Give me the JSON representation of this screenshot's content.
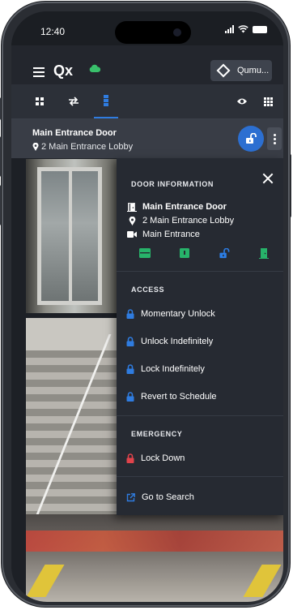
{
  "status_bar": {
    "time": "12:40"
  },
  "header": {
    "logo": "Qx",
    "site_button_label": "Qumu..."
  },
  "tile": {
    "title": "Main Entrance Door",
    "location": "2 Main Entrance Lobby"
  },
  "popover": {
    "door_info": {
      "heading": "DOOR INFORMATION",
      "door_name": "Main Entrance Door",
      "location": "2 Main Entrance Lobby",
      "camera": "Main Entrance"
    },
    "access": {
      "heading": "ACCESS",
      "items": [
        "Momentary Unlock",
        "Unlock Indefinitely",
        "Lock Indefinitely",
        "Revert to Schedule"
      ]
    },
    "emergency": {
      "heading": "EMERGENCY",
      "items": [
        "Lock Down"
      ]
    },
    "search_label": "Go to Search"
  },
  "colors": {
    "accent": "#2c6fd1",
    "door_ok": "#27b36a",
    "emergency_red": "#e0434b",
    "cloud_green": "#39c06b"
  }
}
